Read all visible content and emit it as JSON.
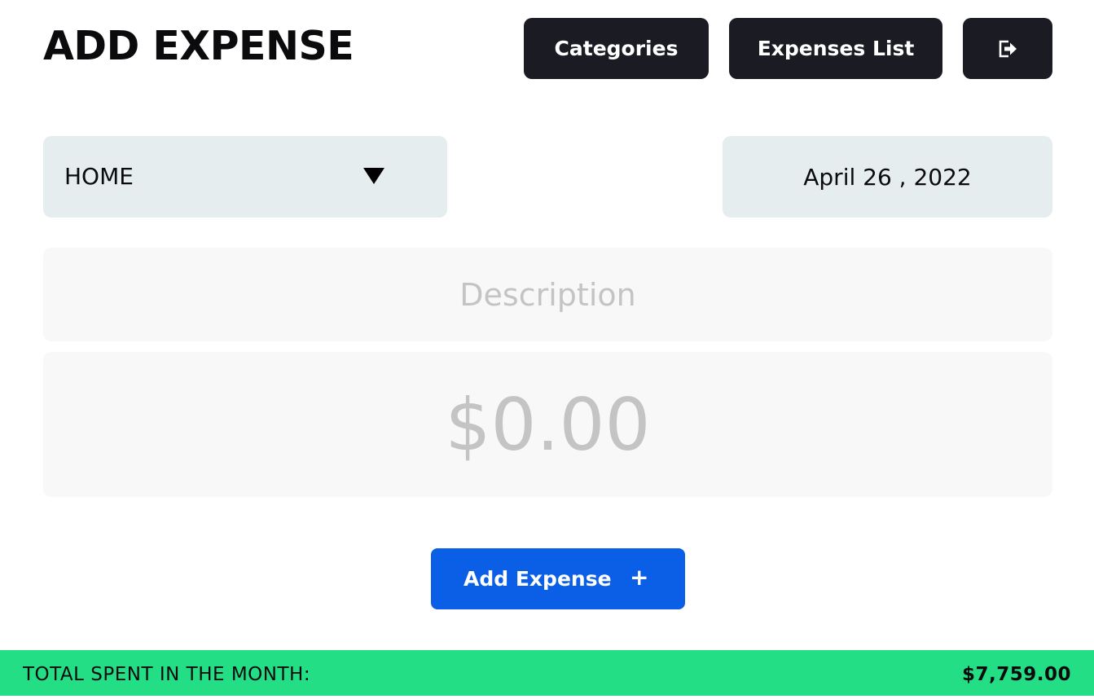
{
  "page": {
    "title": "ADD EXPENSE"
  },
  "nav": {
    "categories_label": "Categories",
    "expenses_list_label": "Expenses List",
    "logout_icon": "logout-icon"
  },
  "form": {
    "category": {
      "selected": "HOME",
      "icon": "dropdown-caret-icon"
    },
    "date": {
      "value": "April 26 , 2022"
    },
    "description": {
      "value": "",
      "placeholder": "Description"
    },
    "amount": {
      "value": "",
      "placeholder": "$0.00"
    },
    "submit": {
      "label": "Add Expense",
      "icon_glyph": "+"
    }
  },
  "summary": {
    "label": "TOTAL SPENT IN THE MONTH:",
    "total": "$7,759.00"
  },
  "colors": {
    "dark_button": "#1b1c23",
    "primary": "#0b5fe6",
    "footer": "#24de86",
    "field_bg": "#e6edef",
    "input_bg": "#f8f8f8",
    "placeholder": "#c4c4c4"
  }
}
